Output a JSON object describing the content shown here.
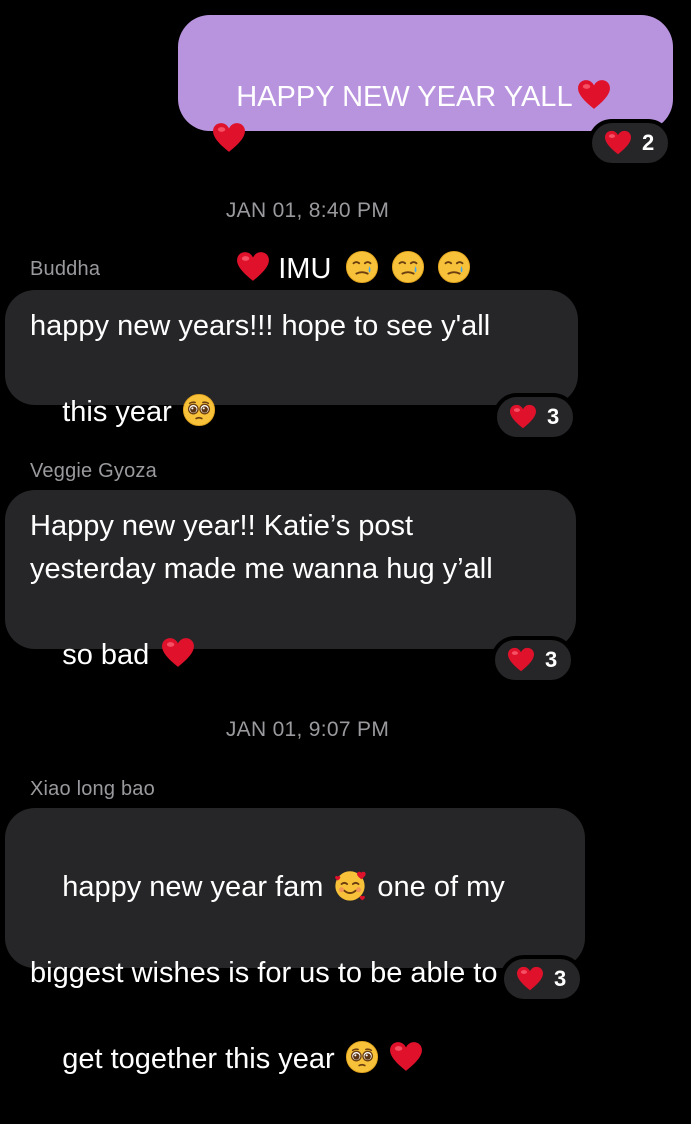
{
  "colors": {
    "background": "#000000",
    "incoming_bubble": "#262628",
    "outgoing_bubble": "#b893de",
    "meta_text": "#9a9a9e",
    "heart": "#e0112b"
  },
  "messages": [
    {
      "direction": "outgoing",
      "line1": "HAPPY NEW YEAR YALL",
      "line2": "IMU",
      "emojis": [
        "red-heart",
        "red-heart",
        "red-heart",
        "smiling-face-with-tear",
        "smiling-face-with-tear",
        "smiling-face-with-tear"
      ],
      "reaction": {
        "icon": "heart-icon",
        "count": "2"
      }
    },
    {
      "timestamp": "JAN 01, 8:40 PM"
    },
    {
      "direction": "incoming",
      "sender": "Buddha",
      "line1": "happy new years!!! hope to see y'all",
      "line2": "this year",
      "emojis": [
        "pleading-face"
      ],
      "reaction": {
        "icon": "heart-icon",
        "count": "3"
      }
    },
    {
      "direction": "incoming",
      "sender": "Veggie Gyoza",
      "line1": "Happy new year!! Katie’s post",
      "line2": "yesterday made me wanna hug y’all",
      "line3": "so bad",
      "emojis": [
        "red-heart"
      ],
      "reaction": {
        "icon": "heart-icon",
        "count": "3"
      }
    },
    {
      "timestamp": "JAN 01, 9:07 PM"
    },
    {
      "direction": "incoming",
      "sender": "Xiao long bao",
      "line1a": "happy new year fam",
      "line1b": "one of my",
      "line2": "biggest wishes is for us to be able to",
      "line3": "get together this year",
      "emojis": [
        "smiling-face-with-hearts",
        "pleading-face",
        "red-heart"
      ],
      "reaction": {
        "icon": "heart-icon",
        "count": "3"
      }
    }
  ]
}
